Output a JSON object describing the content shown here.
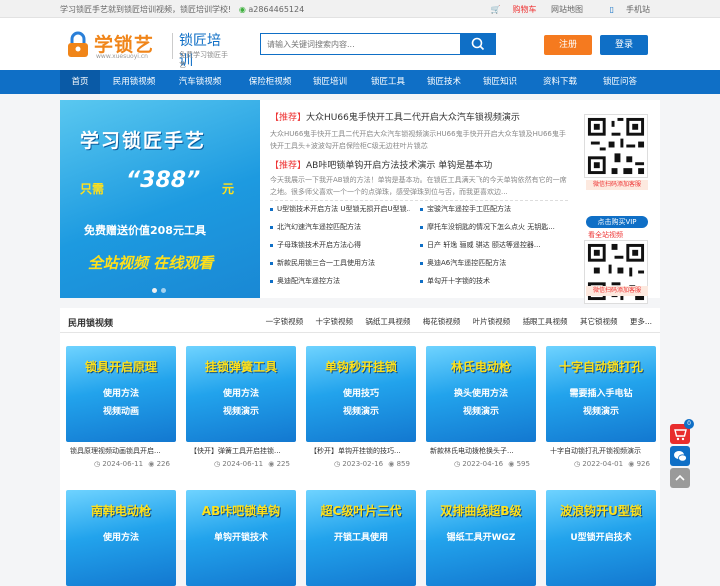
{
  "topbar": {
    "left_text": "学习锁匠手艺就到锁匠培训视频，锁匠培训学校!",
    "wechat": "a2864465124",
    "cart": "购物车",
    "sitemap": "网站地图",
    "mobile": "手机站"
  },
  "logo": {
    "name": "学锁艺",
    "url": "www.xuesuoyi.cn",
    "title": "锁匠培训",
    "slogan": "免费学习锁匠手艺"
  },
  "search": {
    "placeholder": "请输入关键词搜索内容..."
  },
  "auth": {
    "register": "注册",
    "login": "登录"
  },
  "nav": [
    "首页",
    "民用锁视频",
    "汽车锁视频",
    "保险柜视频",
    "锁匠培训",
    "锁匠工具",
    "锁匠技术",
    "锁匠知识",
    "资料下载",
    "锁匠问答"
  ],
  "banner": {
    "line1": "学习锁匠手艺",
    "only": "只需",
    "price": "“388”",
    "unit": "元",
    "line3": "免费赠送价值208元工具",
    "line4": "全站视频  在线观看"
  },
  "news": {
    "tag": "【推荐】",
    "h1": "大众HU66鬼手快开工具二代开启大众汽车锁视频演示",
    "p1": "大众HU66鬼手快开工具二代开启大众汽车锁视频演示HU66鬼手快开开启大众车锁及HU66鬼手快开工具头+波波勾开启保险柜C级无边柱叶片锁芯",
    "h2": "AB咔吧锁单钩开启方法技术演示 单钩是基本功",
    "p2": "今天我展示一下我开AB锁的方法！单钩是基本功。在锁匠工具满天飞的今天单钩依然有它的一席之地。很多师父喜欢一个一个的点弹珠，感受弹珠到位与否，而我更喜欢边...",
    "items": [
      "U型锁技术开启方法 U型锁无损开启U型锁...",
      "宝骏汽车遥控手工匹配方法",
      "北汽幻速汽车遥控匹配方法",
      "摩托车没钥匙的情况下怎么点火 无钥匙...",
      "子母珠锁技术开启方法心得",
      "日产 轩逸 骊威 骐达 颐达等遥控器...",
      "新款民用锁三合一工具使用方法",
      "奥迪A6汽车遥控匹配方法",
      "奥迪配汽车遥控方法",
      "单勾开十字锁的技术"
    ]
  },
  "qr": {
    "tip": "微信扫码添加客服",
    "vip": "点击购买VIP",
    "all": "看全站视频"
  },
  "section": {
    "title": "民用锁视频",
    "tabs": [
      "一字锁视频",
      "十字锁视频",
      "锅纸工具视频",
      "梅花锁视频",
      "叶片锁视频",
      "插眼工具视频",
      "其它锁视频",
      "更多..."
    ]
  },
  "cards": [
    {
      "t1": "锁具开启原理",
      "t2": "使用方法",
      "t3": "视频动画",
      "title": "锁具原理视频动画锁具开启...",
      "date": "2024-06-11",
      "views": "226"
    },
    {
      "t1": "挂锁弹簧工具",
      "t2": "使用方法",
      "t3": "视频演示",
      "title": "【快开】弹簧工具开启挂锁...",
      "date": "2024-06-11",
      "views": "225"
    },
    {
      "t1": "单钩秒开挂锁",
      "t2": "使用技巧",
      "t3": "视频演示",
      "title": "【秒开】单钩开挂锁的技巧...",
      "date": "2023-02-16",
      "views": "859"
    },
    {
      "t1": "林氏电动枪",
      "t2": "换头使用方法",
      "t3": "视频演示",
      "title": "新款林氏电动拨枪换头子...",
      "date": "2022-04-16",
      "views": "595"
    },
    {
      "t1": "十字自动锁打孔",
      "t2": "需要插入手电钻",
      "t3": "视频演示",
      "title": "十字自动锁打孔开锁视频演示",
      "date": "2022-04-01",
      "views": "926"
    },
    {
      "t1": "南韩电动枪",
      "t2": "使用方法",
      "t3": "",
      "title": "",
      "date": "",
      "views": ""
    },
    {
      "t1": "AB咔吧锁单钩",
      "t2": "单钩开锁技术",
      "t3": "",
      "title": "",
      "date": "",
      "views": ""
    },
    {
      "t1": "超C级叶片三代",
      "t2": "开锁工具使用",
      "t3": "",
      "title": "",
      "date": "",
      "views": ""
    },
    {
      "t1": "双排曲线超B级",
      "t2": "锡纸工具开WGZ",
      "t3": "",
      "title": "",
      "date": "",
      "views": ""
    },
    {
      "t1": "波浪钩开U型锁",
      "t2": "U型锁开启技术",
      "t3": "",
      "title": "",
      "date": "",
      "views": ""
    }
  ],
  "float": {
    "cart_count": "0"
  },
  "colors": {
    "brand_blue": "#0f6fc6",
    "orange": "#f57a1f",
    "red": "#e33333"
  }
}
